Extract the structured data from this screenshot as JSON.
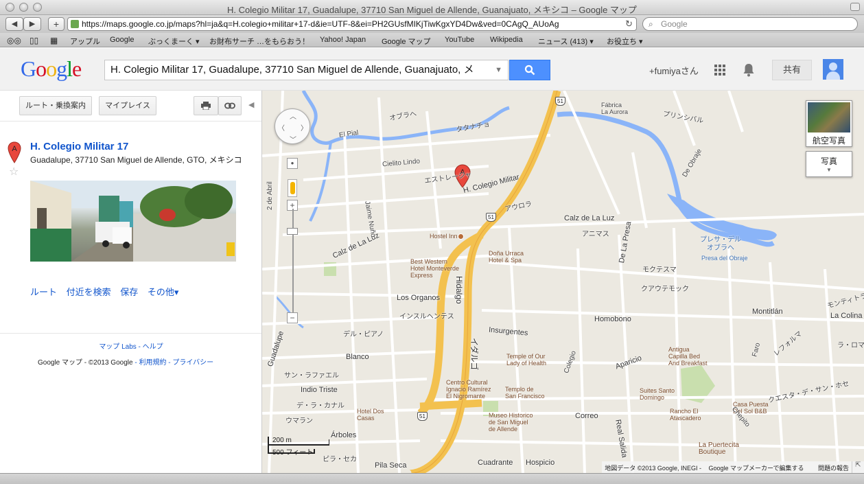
{
  "window": {
    "title": "H. Colegio Militar 17, Guadalupe, 37710 San Miguel de Allende, Guanajuato, メキシコ – Google マップ"
  },
  "browser": {
    "url": "https://maps.google.co.jp/maps?hl=ja&q=H.colegio+militar+17-d&ie=UTF-8&ei=PH2GUsfMIKjTiwKgxYD4Dw&ved=0CAgQ_AUoAg",
    "search_placeholder": "Google",
    "add_label": "+",
    "bookmarks": [
      "アップル",
      "Google",
      "ぶっくまーく ▾",
      "お財布サーチ …をもらおう！",
      "Yahoo! Japan",
      "Google マップ",
      "YouTube",
      "Wikipedia",
      "ニュース (413) ▾",
      "お役立ち ▾"
    ]
  },
  "header": {
    "logo": "Google",
    "search_value": "H. Colegio Militar 17, Guadalupe, 37710 San Miguel de Allende, Guanajuato, メ",
    "user": "+fumiyaさん",
    "share_label": "共有"
  },
  "panel": {
    "route_button": "ルート・乗換案内",
    "myplaces_button": "マイプレイス",
    "marker_letter": "A",
    "result_title": "H. Colegio Militar 17",
    "result_address": "Guadalupe, 37710 San Miguel de Allende, GTO, メキシコ",
    "actions": [
      "ルート",
      "付近を検索",
      "保存",
      "その他▾"
    ],
    "footer_labs": "マップ Labs - ヘルプ",
    "footer_brand": "Google マップ",
    "footer_copy": " - ©2013 Google",
    "footer_terms": " - 利用規約 - プライバシー"
  },
  "map": {
    "marker_letter": "A",
    "satellite_label": "航空写真",
    "photos_label": "写真",
    "scale_metric": "200 m",
    "scale_imperial": "500 フィート",
    "attribution": "地図データ ©2013 Google, INEGI -",
    "mapmaker": "Google マップメーカーで編集する",
    "report": "問題の報告",
    "highway_number": "51",
    "water_label": "プレサ・デル\nオブラヘ",
    "water_label_latin": "Presa del Obraje",
    "labels": {
      "colegio_militar": "H. Colegio Militar",
      "cielito_lindo": "Cielito Lindo",
      "estrella": "エストレージャ",
      "el_pial": "El Pial",
      "obrajeh": "オブラへ",
      "tatanacho": "タタナチョ",
      "fabrica": "Fábrica\nLa Aurora",
      "princesa": "プリンシバル",
      "aurora": "アウロラ",
      "calz_luz": "Calz de La Luz",
      "calz_luz2": "Calz de La Luz",
      "animas": "アニマス",
      "hostel_inn": "Hostel Inn",
      "dona_urraca": "Doña Urraca\nHotel & Spa",
      "best_western": "Best Western\nHotel Monteverde\nExpress",
      "hidalgo": "Hidalgo",
      "hidalgo_jp": "イダルゴ",
      "de_la_presa": "De La Presa",
      "moktezuma": "モクテスマ",
      "cuauhtemoc": "クアウテモック",
      "los_organos": "Los Organos",
      "insurgentes": "インスルヘンテス",
      "insurgentes_es": "Insurgentes",
      "homobono": "Homobono",
      "montitlan": "Montitlán",
      "montitlan_jp": "モンティトラン",
      "la_colina": "La Colina",
      "la_roma": "ラ・ロマ",
      "faro": "Faro",
      "reforma": "レフォルマ",
      "del_piano": "デル・ピアノ",
      "blanco": "Blanco",
      "temple_love": "Temple of Our\nLady of Health",
      "colegio": "Colegio",
      "aparicio": "Aparicio",
      "antigua": "Antigua\nCapilla Bed\nAnd Breakfast",
      "indio_triste": "Indio Triste",
      "san_rafael": "サン・ラファエル",
      "centro_cultural": "Centro Cultural\nIgnacio Ramírez\nEl Nigromante",
      "templo_francisco": "Templo de\nSan Francisco",
      "suites_santo": "Suites Santo\nDomingo",
      "hotel_dos_casas": "Hotel Dos\nCasas",
      "museo": "Museo Historico\nde San Miguel\nde Allende",
      "correo": "Correo",
      "rancho": "Rancho El\nAtascadero",
      "casa_puesta": "Casa Puesta\nDel Sol B&B",
      "uma": "ウマラン",
      "arboles": "Árboles",
      "pila_seca": "Pila Seca",
      "pila_seca_jp": "ピラ・セカ",
      "cuadrante": "Cuadrante",
      "hospicio": "Hospicio",
      "real_salida": "Real Salida",
      "la_puertecita": "La Puertecita\nBoutique",
      "guadalupe": "Guadalupe",
      "calz_luz_jp": "デラ・ルス",
      "dos_de_abril": "2 de Abril",
      "jaime_nuno": "Jaime Nuño",
      "canal": "デ・ラ・カナル",
      "cuesta": "クエスタ・デ・サン・ホセ",
      "chepito": "Chepito",
      "de_obraje": "De Obraje",
      "mezquitera": "メスキテラ"
    }
  }
}
